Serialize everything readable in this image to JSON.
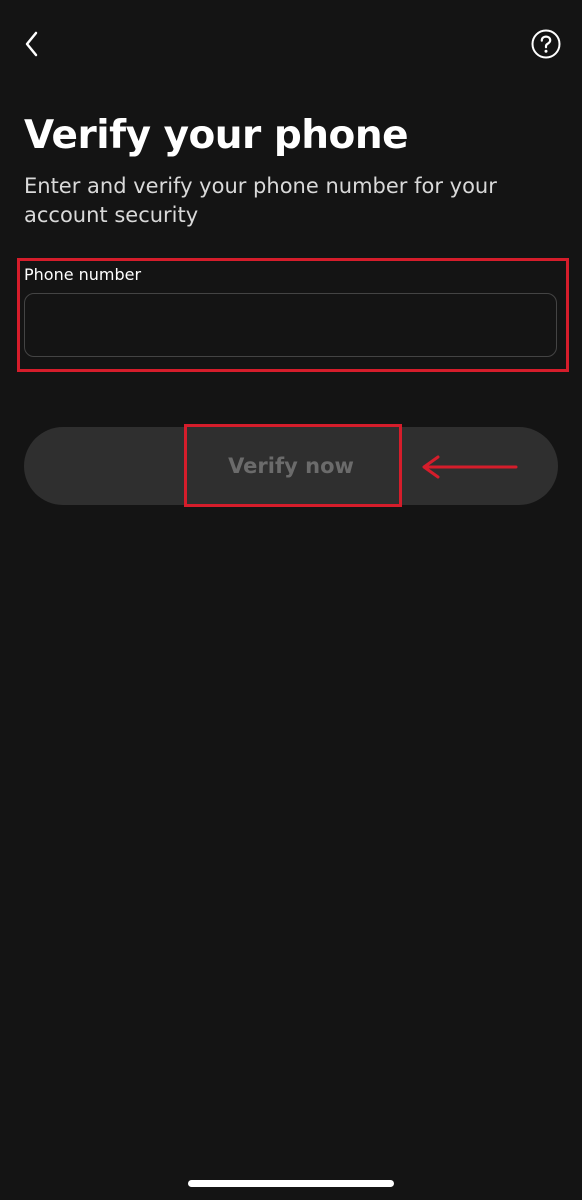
{
  "header": {
    "back_icon": "chevron-left-icon",
    "help_icon": "question-circle-icon"
  },
  "main": {
    "title": "Verify your phone",
    "subtitle": "Enter and verify your phone number for your account security",
    "phone_field": {
      "label": "Phone number",
      "value": "",
      "placeholder": ""
    },
    "verify_button_label": "Verify now"
  },
  "annotations": {
    "highlight_color": "#d51d2b",
    "arrow_icon": "arrow-left-icon"
  },
  "colors": {
    "background": "#141414",
    "button_disabled_bg": "#2f2f2f",
    "button_disabled_text": "#6b6b6b",
    "input_border": "#444444"
  }
}
